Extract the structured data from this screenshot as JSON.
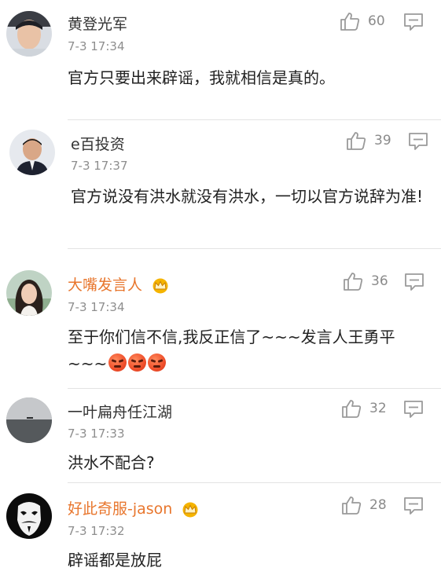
{
  "comments": [
    {
      "username": "黄登光军",
      "time": "7-3 17:34",
      "text": "官方只要出来辟谣，我就相信是真的。",
      "likes": "60",
      "vip": false
    },
    {
      "username": "e百投资",
      "time": "7-3 17:37",
      "text": "官方说没有洪水就没有洪水，一切以官方说辞为准!",
      "likes": "39",
      "vip": false
    },
    {
      "username": "大嘴发言人",
      "time": "7-3 17:34",
      "text": "至于你们信不信,我反正信了~~~发言人王勇平~~~",
      "likes": "36",
      "vip": true
    },
    {
      "username": "一叶扁舟任江湖",
      "time": "7-3 17:33",
      "text": "洪水不配合?",
      "likes": "32",
      "vip": false
    },
    {
      "username": "好此奇服-jason",
      "time": "7-3 17:32",
      "text": "辟谣都是放屁",
      "likes": "28",
      "vip": true
    }
  ],
  "icons": {
    "like": "thumbs-up-icon",
    "reply": "comment-bubble-icon",
    "vip": "crown-badge-icon",
    "emoji": "angry-face-emoji"
  },
  "colors": {
    "vip_name": "#e8762d",
    "normal_name": "#333333",
    "time": "#8e8e8e",
    "icon": "#9a9a9a"
  }
}
